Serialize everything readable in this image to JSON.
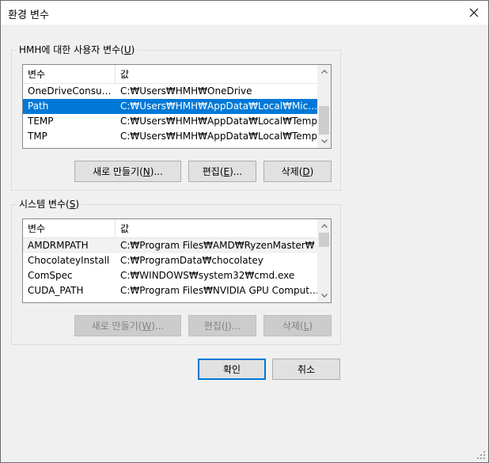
{
  "window": {
    "title": "환경 변수",
    "close_icon": "close-icon"
  },
  "user_vars": {
    "group_label_prefix": "HMH에 대한 사용자 변수(",
    "group_label_key": "U",
    "group_label_suffix": ")",
    "columns": [
      "변수",
      "값"
    ],
    "rows": [
      {
        "name": "OneDriveConsumer",
        "value": "C:₩Users₩HMH₩OneDrive",
        "selected": false
      },
      {
        "name": "Path",
        "value": "C:₩Users₩HMH₩AppData₩Local₩Microso...",
        "selected": true
      },
      {
        "name": "TEMP",
        "value": "C:₩Users₩HMH₩AppData₩Local₩Temp",
        "selected": false
      },
      {
        "name": "TMP",
        "value": "C:₩Users₩HMH₩AppData₩Local₩Temp",
        "selected": false
      }
    ],
    "buttons": {
      "new_prefix": "새로 만들기(",
      "new_key": "N",
      "new_suffix": ")...",
      "edit_prefix": "편집(",
      "edit_key": "E",
      "edit_suffix": ")...",
      "delete_prefix": "삭제(",
      "delete_key": "D",
      "delete_suffix": ")"
    }
  },
  "system_vars": {
    "group_label_prefix": "시스템 변수(",
    "group_label_key": "S",
    "group_label_suffix": ")",
    "columns": [
      "변수",
      "값"
    ],
    "rows": [
      {
        "name": "AMDRMPATH",
        "value": "C:₩Program Files₩AMD₩RyzenMaster₩",
        "selected": false
      },
      {
        "name": "ChocolateyInstall",
        "value": "C:₩ProgramData₩chocolatey",
        "selected": false
      },
      {
        "name": "ComSpec",
        "value": "C:₩WINDOWS₩system32₩cmd.exe",
        "selected": false
      },
      {
        "name": "CUDA_PATH",
        "value": "C:₩Program Files₩NVIDIA GPU Computing...",
        "selected": false
      }
    ],
    "buttons": {
      "new_prefix": "새로 만들기(",
      "new_key": "W",
      "new_suffix": ")...",
      "edit_prefix": "편집(",
      "edit_key": "I",
      "edit_suffix": ")...",
      "delete_prefix": "삭제(",
      "delete_key": "L",
      "delete_suffix": ")"
    }
  },
  "footer": {
    "ok_label": "확인",
    "cancel_label": "취소"
  },
  "colors": {
    "selection": "#0078d7",
    "default_border": "#0078d7"
  }
}
